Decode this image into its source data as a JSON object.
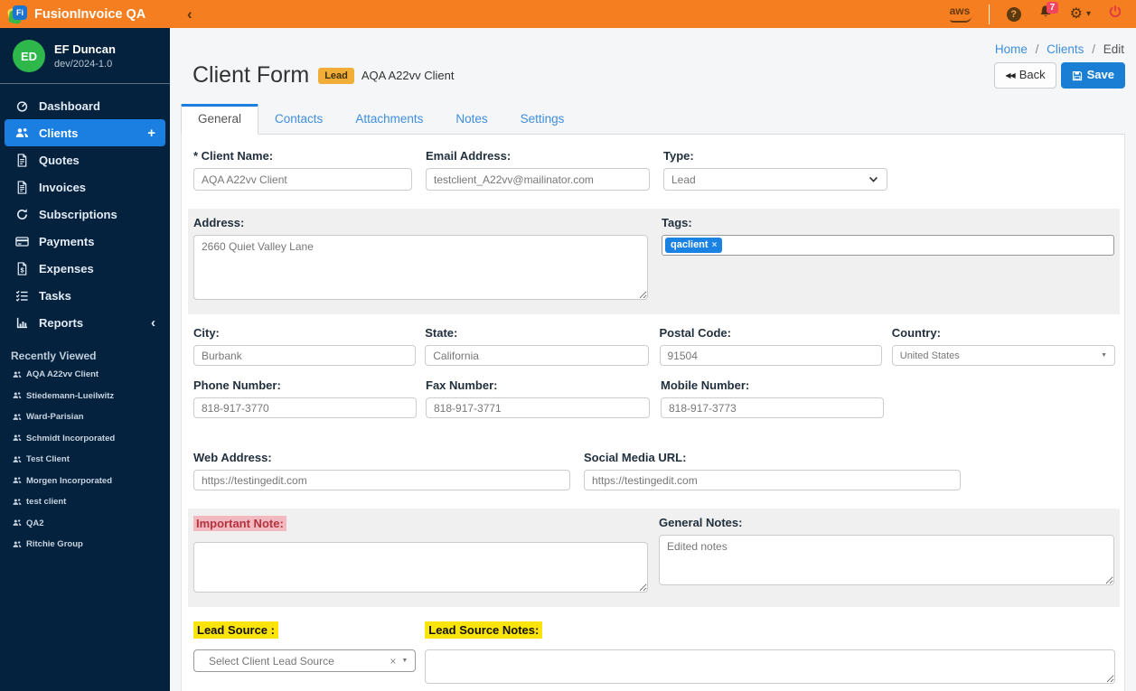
{
  "colors": {
    "topbar_orange": "#f47e20",
    "sidebar_navy": "#04223e",
    "active_blue": "#1a7fe0",
    "save_blue": "#1a7fd4",
    "badge_yellow": "#f0ad37",
    "tag_blue": "#1a82e2",
    "danger_red": "#b3323e",
    "note_pink_highlight": "#f2b9c1",
    "yellow_highlight": "#fbe409",
    "power_red": "#e03148"
  },
  "icons": {
    "collapse": "‹",
    "plus": "+",
    "chevron_left": "‹",
    "help": "?",
    "gear": "⚙",
    "caret_down": "▾",
    "caret_small": "▼",
    "back": "◀◀",
    "breadcrumb_separator": "/",
    "clear": "×"
  },
  "topbar": {
    "brand": "FusionInvoice QA",
    "logo_text": "Fi",
    "aws_label": "aws",
    "notification_count": "7"
  },
  "sidebar": {
    "user": {
      "initials": "ED",
      "name": "EF Duncan",
      "version": "dev/2024-1.0"
    },
    "nav": [
      {
        "label": "Dashboard"
      },
      {
        "label": "Clients"
      },
      {
        "label": "Quotes"
      },
      {
        "label": "Invoices"
      },
      {
        "label": "Subscriptions"
      },
      {
        "label": "Payments"
      },
      {
        "label": "Expenses"
      },
      {
        "label": "Tasks"
      },
      {
        "label": "Reports"
      }
    ],
    "recent": {
      "title": "Recently Viewed",
      "items": [
        {
          "label": "AQA A22vv Client"
        },
        {
          "label": "Stiedemann-Lueilwitz"
        },
        {
          "label": "Ward-Parisian"
        },
        {
          "label": "Schmidt Incorporated"
        },
        {
          "label": "Test Client"
        },
        {
          "label": "Morgen Incorporated"
        },
        {
          "label": "test client"
        },
        {
          "label": "QA2"
        },
        {
          "label": "Ritchie Group"
        }
      ]
    }
  },
  "header": {
    "breadcrumb": {
      "home": "Home",
      "clients": "Clients",
      "current": "Edit"
    },
    "title": "Client Form",
    "badge": "Lead",
    "subtitle": "AQA A22vv Client",
    "back_label": "Back",
    "save_label": "Save"
  },
  "tabs": {
    "items": [
      {
        "label": "General"
      },
      {
        "label": "Contacts"
      },
      {
        "label": "Attachments"
      },
      {
        "label": "Notes"
      },
      {
        "label": "Settings"
      }
    ]
  },
  "form": {
    "client_name": {
      "label": "* Client Name:",
      "value": "AQA A22vv Client"
    },
    "email": {
      "label": "Email Address:",
      "value": "testclient_A22vv@mailinator.com"
    },
    "type": {
      "label": "Type:",
      "value": "Lead"
    },
    "address": {
      "label": "Address:",
      "value": "2660 Quiet Valley Lane"
    },
    "tags": {
      "label": "Tags:",
      "chip": "qaclient",
      "chip_close": "×"
    },
    "city": {
      "label": "City:",
      "value": "Burbank"
    },
    "state": {
      "label": "State:",
      "value": "California"
    },
    "postal_code": {
      "label": "Postal Code:",
      "value": "91504"
    },
    "country": {
      "label": "Country:",
      "value": "United States"
    },
    "phone": {
      "label": "Phone Number:",
      "value": "818-917-3770"
    },
    "fax": {
      "label": "Fax Number:",
      "value": "818-917-3771"
    },
    "mobile": {
      "label": "Mobile Number:",
      "value": "818-917-3773"
    },
    "web": {
      "label": "Web Address:",
      "value": "https://testingedit.com"
    },
    "social": {
      "label": "Social Media URL:",
      "value": "https://testingedit.com"
    },
    "important_note": {
      "label": "Important Note:",
      "value": ""
    },
    "general_notes": {
      "label": "General Notes:",
      "value": "Edited notes"
    },
    "lead_source": {
      "label": "Lead Source :",
      "placeholder": "Select Client Lead Source"
    },
    "lead_source_notes": {
      "label": "Lead Source Notes:",
      "value": ""
    }
  }
}
